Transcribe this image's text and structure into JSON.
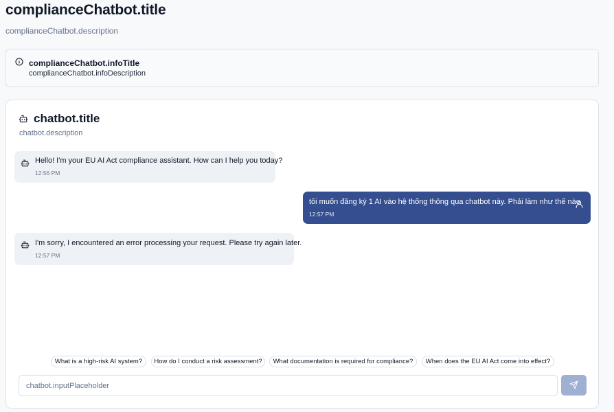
{
  "page": {
    "title": "complianceChatbot.title",
    "description": "complianceChatbot.description"
  },
  "info": {
    "title": "complianceChatbot.infoTitle",
    "description": "complianceChatbot.infoDescription",
    "icon": "info-circle-icon"
  },
  "chatbot": {
    "title": "chatbot.title",
    "description": "chatbot.description",
    "icon": "bot-icon",
    "input_placeholder": "chatbot.inputPlaceholder",
    "send_icon": "send-icon"
  },
  "messages": [
    {
      "sender": "bot",
      "text": "Hello! I'm your EU AI Act compliance assistant. How can I help you today?",
      "time": "12:56 PM"
    },
    {
      "sender": "user",
      "text": "tôi muốn đăng ký 1 AI vào hệ thống thông qua chatbot này. Phải làm như thế nào",
      "time": "12:57 PM"
    },
    {
      "sender": "bot",
      "text": "I'm sorry, I encountered an error processing your request. Please try again later.",
      "time": "12:57 PM"
    }
  ],
  "suggestions": [
    "What is a high-risk AI system?",
    "How do I conduct a risk assessment?",
    "What documentation is required for compliance?",
    "When does the EU AI Act come into effect?"
  ],
  "colors": {
    "user_bubble": "#344e8f",
    "bot_bubble": "#eef2f6",
    "send_button": "#9fb0d2"
  }
}
